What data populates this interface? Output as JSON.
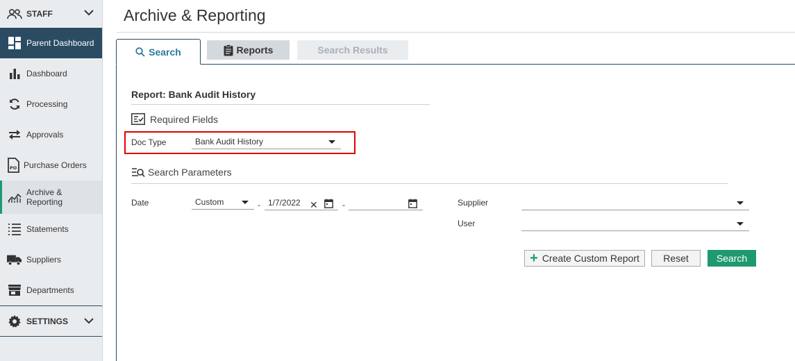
{
  "sidebar": {
    "staff_label": "STAFF",
    "parent_dashboard": "Parent Dashboard",
    "items": [
      {
        "label": "Dashboard",
        "icon": "bar-chart-icon"
      },
      {
        "label": "Processing",
        "icon": "refresh-icon"
      },
      {
        "label": "Approvals",
        "icon": "swap-arrows-icon"
      },
      {
        "label": "Purchase Orders",
        "icon": "po-document-icon"
      },
      {
        "label_line1": "Archive &",
        "label_line2": "Reporting",
        "icon": "line-chart-icon",
        "active": true
      },
      {
        "label": "Statements",
        "icon": "list-icon"
      },
      {
        "label": "Suppliers",
        "icon": "truck-icon"
      },
      {
        "label": "Departments",
        "icon": "store-icon"
      }
    ],
    "settings_label": "SETTINGS"
  },
  "page": {
    "title": "Archive & Reporting"
  },
  "tabs": {
    "search": "Search",
    "reports": "Reports",
    "results": "Search Results"
  },
  "form": {
    "report_title": "Report: Bank Audit History",
    "required_fields": "Required Fields",
    "doc_type_label": "Doc Type",
    "doc_type_value": "Bank Audit History",
    "search_parameters": "Search Parameters",
    "date_label": "Date",
    "date_mode": "Custom",
    "date_sep": "-",
    "date_from": "1/7/2022",
    "date_to": "",
    "supplier_label": "Supplier",
    "supplier_value": "",
    "user_label": "User",
    "user_value": ""
  },
  "buttons": {
    "create_custom_report": "Create Custom Report",
    "reset": "Reset",
    "search": "Search"
  },
  "colors": {
    "sidebar_bg": "#e9ecef",
    "nav_dark": "#2b4b63",
    "accent_green": "#1f9a6e",
    "highlight_red": "#e00000",
    "tab_active_text": "#2b7a9e"
  }
}
